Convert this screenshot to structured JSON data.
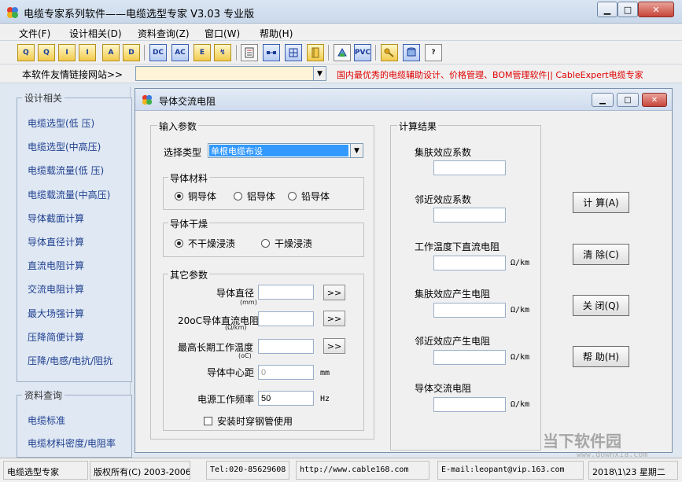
{
  "app": {
    "title": "电缆专家系列软件——电缆选型专家  V3.03 专业版"
  },
  "menu": [
    "文件(F)",
    "设计相关(D)",
    "资料查询(Z)",
    "窗口(W)",
    "帮助(H)"
  ],
  "toolbar": {
    "buttons": [
      "Q",
      "Q",
      "I",
      "I",
      "A",
      "D",
      "DC",
      "AC",
      "E",
      "↯",
      "",
      "",
      "",
      "",
      "",
      "PVC",
      "",
      "",
      "?"
    ]
  },
  "links": {
    "label": "本软件友情链接网站>>",
    "select_value": "",
    "marquee": "国内最优秀的电缆辅助设计、价格管理、BOM管理软件|| CableExpert电缆专家"
  },
  "sidebar": {
    "groups": [
      {
        "title": "设计相关",
        "items": [
          "电缆选型(低 压)",
          "电缆选型(中高压)",
          "电缆载流量(低 压)",
          "电缆载流量(中高压)",
          "导体截面计算",
          "导体直径计算",
          "直流电阻计算",
          "交流电阻计算",
          "最大场强计算",
          "压降简便计算",
          "压降/电感/电抗/阻抗"
        ]
      },
      {
        "title": "资料查询",
        "items": [
          "电缆标准",
          "电缆材料密度/电阻率"
        ]
      }
    ]
  },
  "child": {
    "title": "导体交流电阻",
    "input_group": "输入参数",
    "type_label": "选择类型",
    "type_value": "单根电缆布设",
    "material": {
      "title": "导体材料",
      "options": [
        "铜导体",
        "铝导体",
        "铅导体"
      ],
      "selected": 0
    },
    "dry": {
      "title": "导体干燥",
      "options": [
        "不干燥浸渍",
        "干燥浸渍"
      ],
      "selected": 0
    },
    "other": {
      "title": "其它参数",
      "diameter_label": "导体直径",
      "diameter_unit": "(mm)",
      "resistance_label": "20oC导体直流电阻",
      "resistance_unit": "(Ω/km)",
      "temp_label": "最高长期工作温度",
      "temp_unit": "(oC)",
      "center_label": "导体中心距",
      "center_value": "0",
      "center_unit": "mm",
      "freq_label": "电源工作频率",
      "freq_value": "50",
      "freq_unit": "Hz",
      "steel_label": "安装时穿钢管使用",
      "pick_button": ">>"
    },
    "result_group": "计算结果",
    "results": [
      {
        "label": "集肤效应系数",
        "unit": ""
      },
      {
        "label": "邻近效应系数",
        "unit": ""
      },
      {
        "label": "工作温度下直流电阻",
        "unit": "Ω/km"
      },
      {
        "label": "集肤效应产生电阻",
        "unit": "Ω/km"
      },
      {
        "label": "邻近效应产生电阻",
        "unit": "Ω/km"
      },
      {
        "label": "导体交流电阻",
        "unit": "Ω/km"
      }
    ],
    "buttons": [
      "计 算(A)",
      "清 除(C)",
      "关 闭(Q)",
      "帮 助(H)"
    ]
  },
  "status": [
    "电缆选型专家",
    "版权所有(C) 2003-2006",
    "Tel:020-85629608",
    "http://www.cable168.com",
    "E-mail:leopant@vip.163.com",
    "2018\\1\\23 星期二"
  ],
  "watermark": {
    "line1": "当下软件园",
    "line2": "www.downxia.com"
  }
}
